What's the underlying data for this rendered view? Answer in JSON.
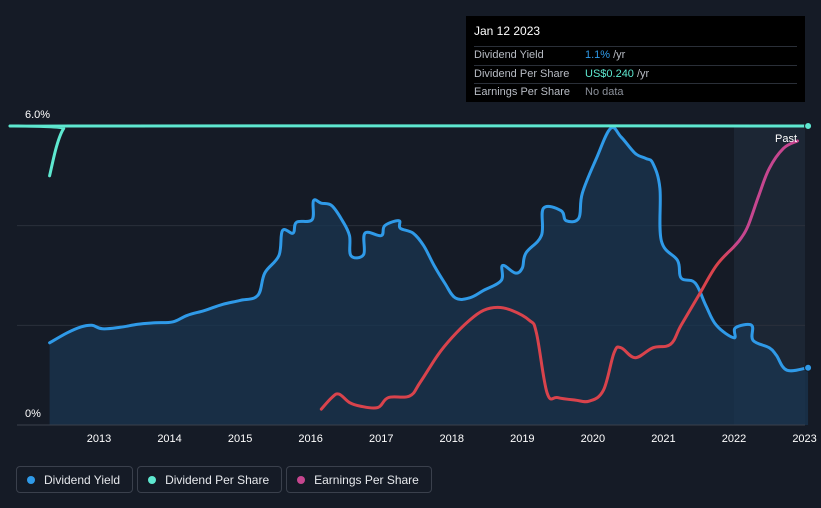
{
  "tooltip": {
    "date": "Jan 12 2023",
    "rows": [
      {
        "label": "Dividend Yield",
        "value": "1.1%",
        "unit": "/yr"
      },
      {
        "label": "Dividend Per Share",
        "value": "US$0.240",
        "unit": "/yr"
      },
      {
        "label": "Earnings Per Share",
        "value": "No data",
        "unit": ""
      }
    ]
  },
  "past_label": "Past",
  "legend": [
    {
      "label": "Dividend Yield",
      "color": "#2f9ae8"
    },
    {
      "label": "Dividend Per Share",
      "color": "#5ee8d0"
    },
    {
      "label": "Earnings Per Share",
      "color": "#c6468f"
    }
  ],
  "chart_data": {
    "type": "line",
    "x_ticks": [
      "2013",
      "2014",
      "2015",
      "2016",
      "2017",
      "2018",
      "2019",
      "2020",
      "2021",
      "2022",
      "2023"
    ],
    "y_ticks": [
      "6.0%",
      "0%"
    ],
    "ylim": [
      0,
      6
    ],
    "xlim": [
      2012.3,
      2023.05
    ],
    "past_region_start": 2022.0,
    "colors": {
      "yield": "#2f9ae8",
      "dps": "#5ee8d0",
      "eps": "#d9434c",
      "eps_high": "#c6468f",
      "grid": "#2a303b",
      "fill": "#1a3550",
      "past_fill": "#1c2634"
    },
    "series": [
      {
        "name": "Dividend Yield",
        "points": [
          [
            2012.3,
            1.65
          ],
          [
            2012.55,
            1.85
          ],
          [
            2012.75,
            1.97
          ],
          [
            2012.9,
            2.0
          ],
          [
            2013.05,
            1.93
          ],
          [
            2013.3,
            1.96
          ],
          [
            2013.55,
            2.02
          ],
          [
            2013.8,
            2.05
          ],
          [
            2014.05,
            2.07
          ],
          [
            2014.25,
            2.2
          ],
          [
            2014.5,
            2.3
          ],
          [
            2014.75,
            2.42
          ],
          [
            2015.0,
            2.5
          ],
          [
            2015.25,
            2.6
          ],
          [
            2015.35,
            3.05
          ],
          [
            2015.55,
            3.4
          ],
          [
            2015.6,
            3.9
          ],
          [
            2015.75,
            3.85
          ],
          [
            2015.8,
            4.07
          ],
          [
            2016.02,
            4.12
          ],
          [
            2016.04,
            4.5
          ],
          [
            2016.15,
            4.45
          ],
          [
            2016.3,
            4.4
          ],
          [
            2016.45,
            4.1
          ],
          [
            2016.55,
            3.8
          ],
          [
            2016.57,
            3.4
          ],
          [
            2016.75,
            3.42
          ],
          [
            2016.77,
            3.85
          ],
          [
            2017.0,
            3.8
          ],
          [
            2017.05,
            4.0
          ],
          [
            2017.25,
            4.1
          ],
          [
            2017.27,
            3.95
          ],
          [
            2017.45,
            3.85
          ],
          [
            2017.6,
            3.6
          ],
          [
            2017.75,
            3.2
          ],
          [
            2017.9,
            2.85
          ],
          [
            2018.05,
            2.55
          ],
          [
            2018.25,
            2.55
          ],
          [
            2018.45,
            2.7
          ],
          [
            2018.7,
            2.9
          ],
          [
            2018.72,
            3.2
          ],
          [
            2018.9,
            3.05
          ],
          [
            2019.0,
            3.15
          ],
          [
            2019.05,
            3.45
          ],
          [
            2019.27,
            3.8
          ],
          [
            2019.3,
            4.35
          ],
          [
            2019.55,
            4.3
          ],
          [
            2019.62,
            4.1
          ],
          [
            2019.8,
            4.15
          ],
          [
            2019.85,
            4.65
          ],
          [
            2020.05,
            5.35
          ],
          [
            2020.25,
            5.95
          ],
          [
            2020.4,
            5.78
          ],
          [
            2020.6,
            5.45
          ],
          [
            2020.75,
            5.35
          ],
          [
            2020.85,
            5.25
          ],
          [
            2020.95,
            4.75
          ],
          [
            2020.97,
            3.7
          ],
          [
            2021.2,
            3.3
          ],
          [
            2021.25,
            2.95
          ],
          [
            2021.45,
            2.85
          ],
          [
            2021.6,
            2.4
          ],
          [
            2021.75,
            2.0
          ],
          [
            2022.0,
            1.75
          ],
          [
            2022.02,
            1.95
          ],
          [
            2022.25,
            2.0
          ],
          [
            2022.27,
            1.7
          ],
          [
            2022.5,
            1.55
          ],
          [
            2022.6,
            1.4
          ],
          [
            2022.75,
            1.1
          ],
          [
            2023.05,
            1.15
          ]
        ]
      },
      {
        "name": "Dividend Per Share",
        "points": [
          [
            2012.3,
            5.0
          ],
          [
            2012.4,
            5.6
          ],
          [
            2012.5,
            5.95
          ],
          [
            2012.6,
            6.0
          ],
          [
            2023.05,
            6.0
          ]
        ]
      },
      {
        "name": "Earnings Per Share",
        "points": [
          [
            2016.15,
            0.32
          ],
          [
            2016.3,
            0.55
          ],
          [
            2016.4,
            0.62
          ],
          [
            2016.55,
            0.45
          ],
          [
            2016.7,
            0.38
          ],
          [
            2016.95,
            0.35
          ],
          [
            2017.1,
            0.55
          ],
          [
            2017.4,
            0.58
          ],
          [
            2017.55,
            0.85
          ],
          [
            2017.8,
            1.4
          ],
          [
            2018.0,
            1.75
          ],
          [
            2018.25,
            2.1
          ],
          [
            2018.45,
            2.3
          ],
          [
            2018.65,
            2.36
          ],
          [
            2018.85,
            2.3
          ],
          [
            2019.1,
            2.1
          ],
          [
            2019.2,
            1.85
          ],
          [
            2019.35,
            0.65
          ],
          [
            2019.5,
            0.55
          ],
          [
            2019.75,
            0.5
          ],
          [
            2019.95,
            0.48
          ],
          [
            2020.15,
            0.7
          ],
          [
            2020.3,
            1.45
          ],
          [
            2020.4,
            1.55
          ],
          [
            2020.6,
            1.35
          ],
          [
            2020.85,
            1.55
          ],
          [
            2021.1,
            1.62
          ],
          [
            2021.25,
            2.0
          ],
          [
            2021.5,
            2.6
          ],
          [
            2021.75,
            3.2
          ],
          [
            2022.0,
            3.58
          ],
          [
            2022.1,
            3.75
          ],
          [
            2022.2,
            4.0
          ],
          [
            2022.35,
            4.6
          ],
          [
            2022.5,
            5.15
          ],
          [
            2022.7,
            5.55
          ],
          [
            2022.9,
            5.7
          ]
        ]
      }
    ]
  }
}
